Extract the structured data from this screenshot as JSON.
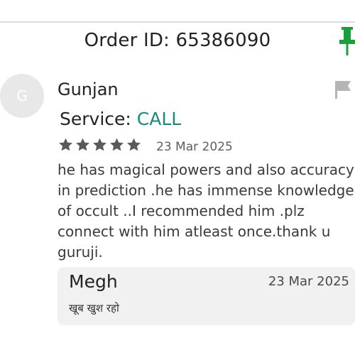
{
  "header": {
    "order_id_text": "Order ID: 65386090",
    "pin_icon": "pin-icon",
    "pin_color": "#1e9e3a"
  },
  "review": {
    "avatar_initial": "G",
    "reviewer_name": "Gunjan",
    "service_label": "Service: ",
    "service_value": "CALL",
    "service_color": "#1a8a78",
    "rating": 5,
    "rating_max": 5,
    "date": "23 Mar 2025",
    "text_lines": [
      "he has magical powers and also accuracy",
      "in prediction .he has immense knowledge",
      "of occult ..I recommended him .plz",
      "connect with him atleast once.thank u",
      "guruji."
    ],
    "flag_icon": "flag-icon"
  },
  "reply": {
    "name": "Megh",
    "date": "23 Mar 2025",
    "text": "खूब खुश रहो"
  }
}
